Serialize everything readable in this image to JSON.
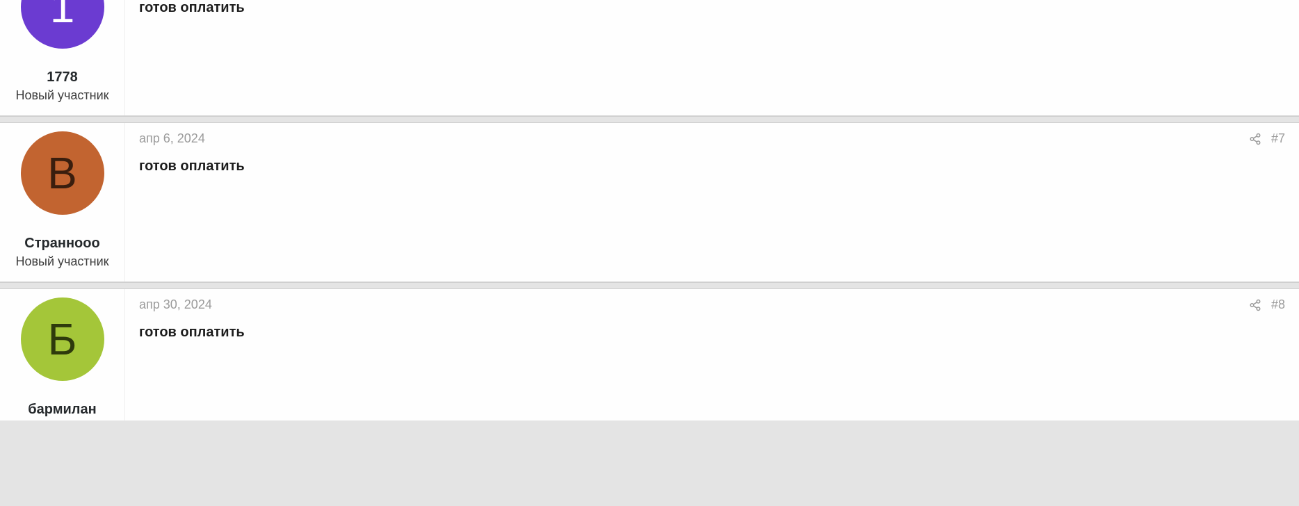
{
  "posts": [
    {
      "avatar": {
        "letter": "1",
        "bg": "#6b3bd1",
        "fg": "#ffffff",
        "partial": true
      },
      "username": "1778",
      "user_title": "Новый участник",
      "date": "",
      "post_num": "",
      "body": "готов оплатить"
    },
    {
      "avatar": {
        "letter": "В",
        "bg": "#c26430",
        "fg": "#3a1e0e",
        "partial": false
      },
      "username": "Страннооо",
      "user_title": "Новый участник",
      "date": "апр 6, 2024",
      "post_num": "#7",
      "body": "готов оплатить"
    },
    {
      "avatar": {
        "letter": "Б",
        "bg": "#a4c639",
        "fg": "#2e3a0c",
        "partial": false
      },
      "username": "бармилан",
      "user_title": "",
      "date": "апр 30, 2024",
      "post_num": "#8",
      "body": "готов оплатить"
    }
  ]
}
